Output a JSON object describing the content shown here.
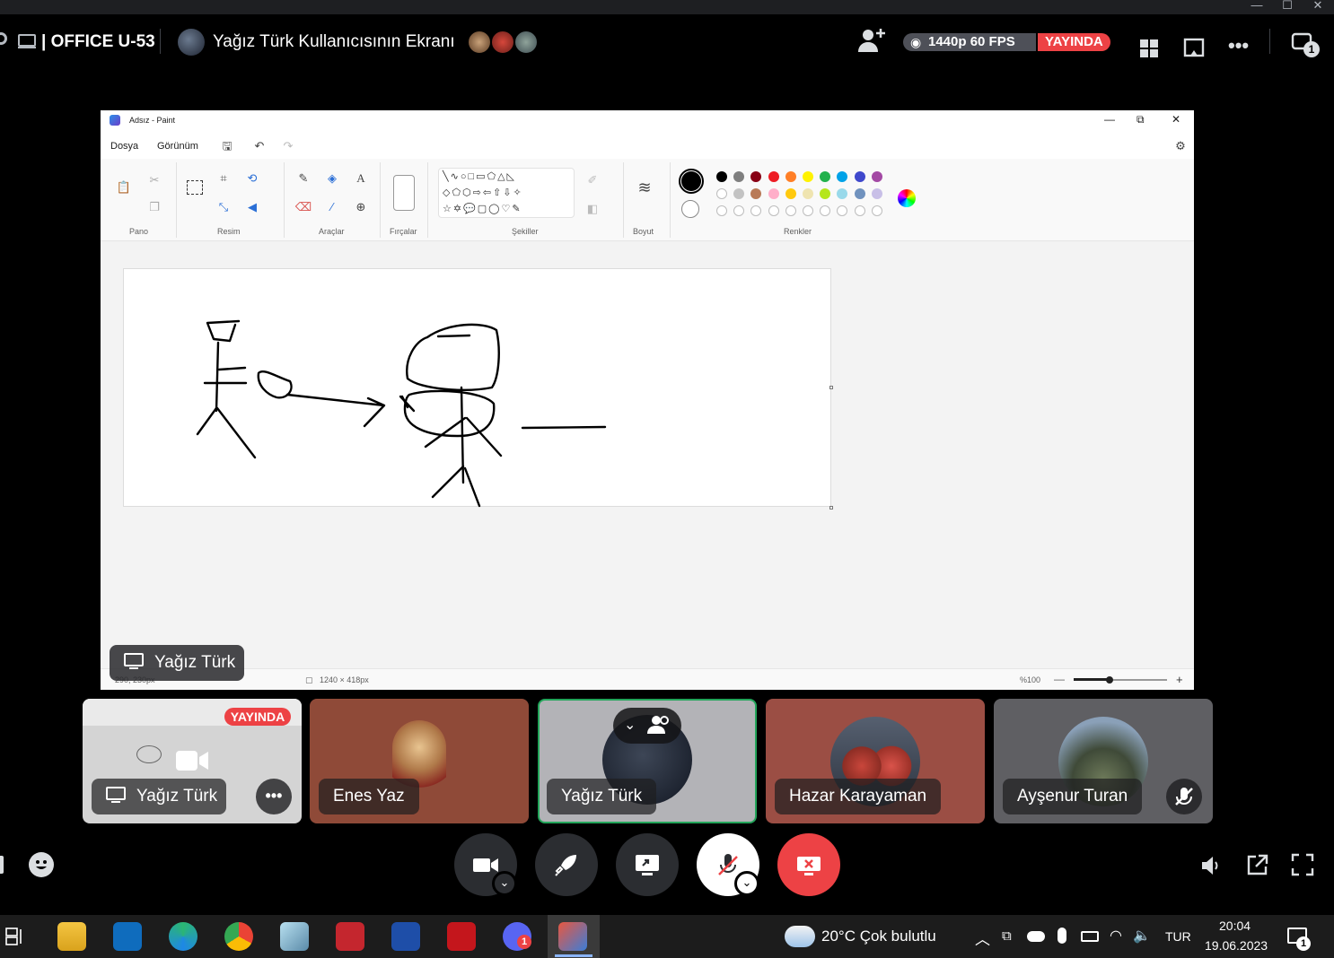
{
  "header": {
    "server": "| OFFICE U-53",
    "screen_title": "Yağız Türk Kullanıcısının Ekranı",
    "quality": "1440p 60 FPS",
    "live": "YAYINDA",
    "inbox_count": "1"
  },
  "paint": {
    "title": "Adsız - Paint",
    "menu": [
      "Dosya",
      "Görünüm"
    ],
    "groups": [
      "Pano",
      "Resim",
      "Araçlar",
      "Fırçalar",
      "Şekiller",
      "Boyut",
      "Renkler"
    ],
    "status": {
      "cursor": "290, 230px",
      "size": "1240 × 418px",
      "zoom": "%100"
    },
    "palette_row1": [
      "#000000",
      "#7f7f7f",
      "#880015",
      "#ed1c24",
      "#ff7f27",
      "#fff200",
      "#22b14c",
      "#00a2e8",
      "#3f48cc",
      "#a349a4"
    ],
    "palette_row2": [
      "#ffffff",
      "#c3c3c3",
      "#b97a57",
      "#ffaec9",
      "#ffc90e",
      "#efe4b0",
      "#b5e61d",
      "#99d9ea",
      "#7092be",
      "#c8bfe7"
    ]
  },
  "share_badge": "Yağız Türk",
  "tiles": [
    {
      "name": "Yağız Türk",
      "badge": "YAYINDA"
    },
    {
      "name": "Enes Yaz"
    },
    {
      "name": "Yağız Türk"
    },
    {
      "name": "Hazar Karayaman"
    },
    {
      "name": "Ayşenur Turan"
    }
  ],
  "taskbar": {
    "weather": "20°C  Çok bulutlu",
    "lang": "TUR",
    "time": "20:04",
    "date": "19.06.2023",
    "notif_count": "1",
    "discord_badge": "1"
  }
}
